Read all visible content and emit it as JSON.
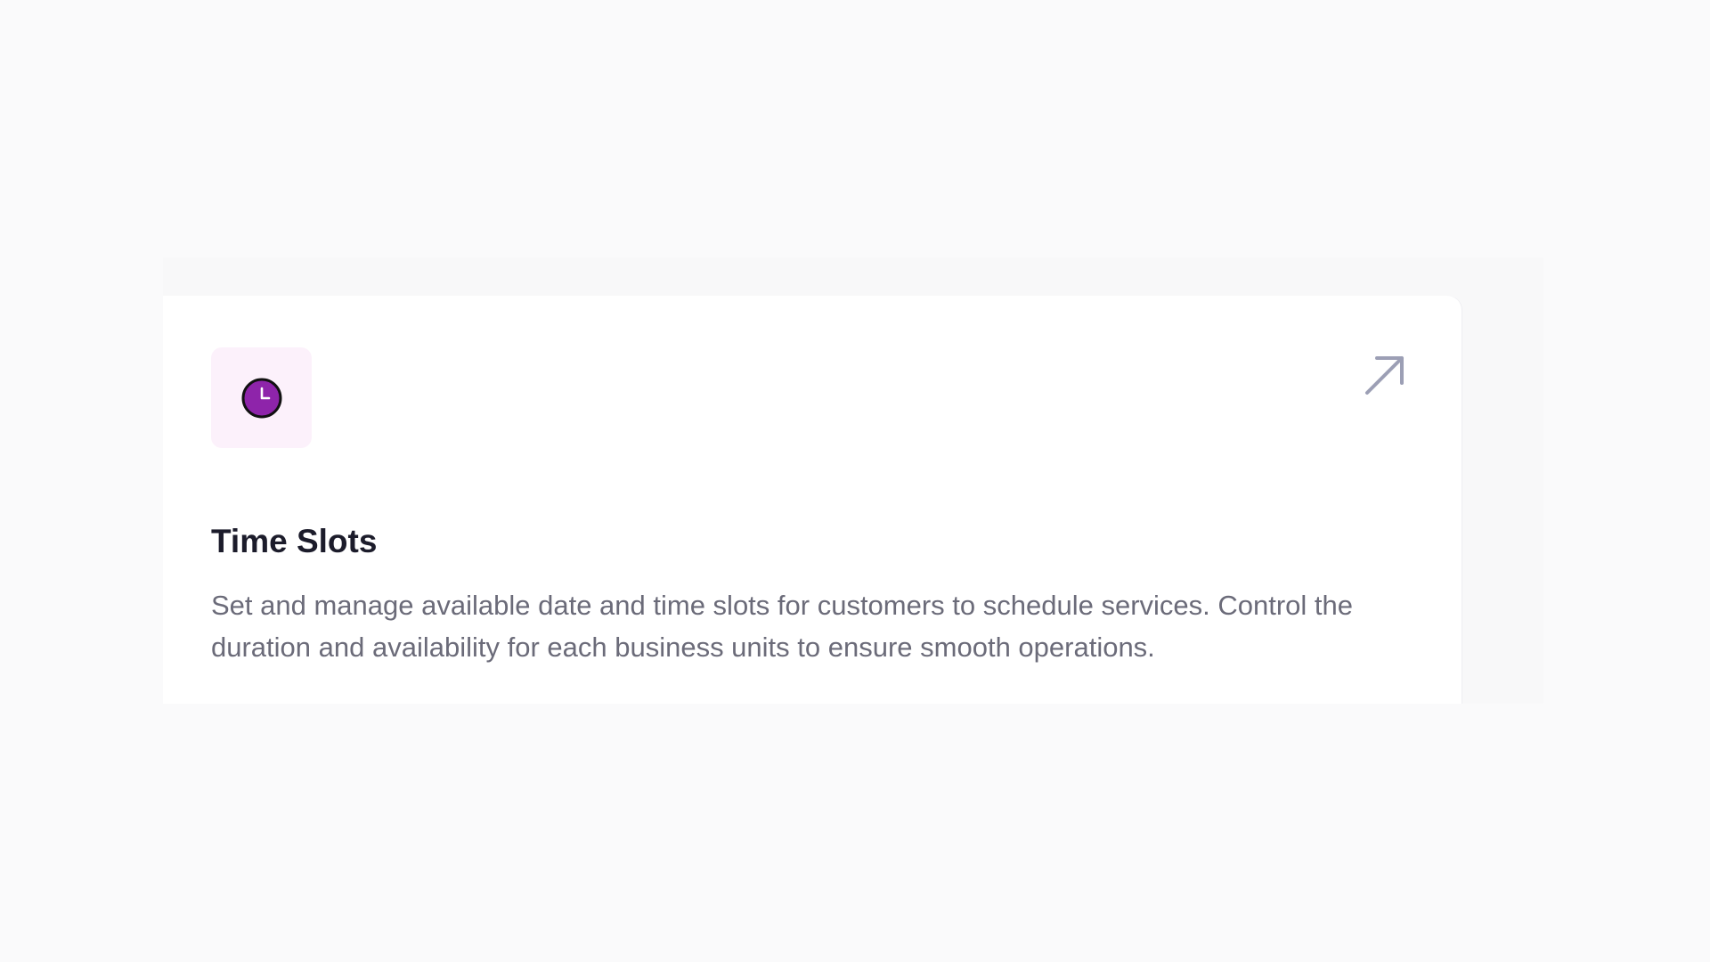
{
  "card": {
    "title": "Time Slots",
    "description": "Set and manage available date and time slots for customers to schedule services. Control the duration and availability for each business units to ensure smooth operations.",
    "icon": "clock-icon",
    "action_icon": "arrow-up-right-icon"
  },
  "colors": {
    "page_background": "#fafafb",
    "card_background": "#ffffff",
    "icon_tile_background": "#fcf1fb",
    "icon_fill": "#8e24aa",
    "icon_stroke": "#111111",
    "action_icon": "#9c9fb5",
    "title": "#1c1c2b",
    "description": "#6b6b79"
  }
}
